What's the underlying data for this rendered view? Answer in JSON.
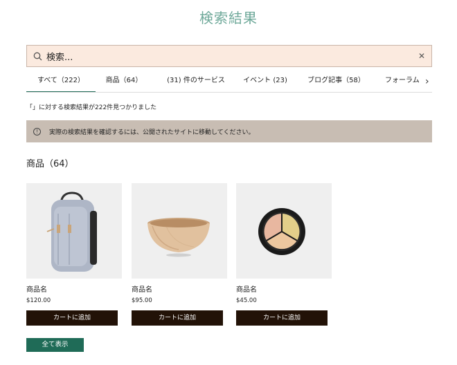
{
  "page": {
    "title": "検索結果"
  },
  "search": {
    "value": "検索..."
  },
  "tabs": [
    {
      "label": "すべて（222）"
    },
    {
      "label": "商品（64）"
    },
    {
      "label": "(31) 件のサービス"
    },
    {
      "label": "イベント (23)"
    },
    {
      "label": "ブログ記事（58）"
    },
    {
      "label": "フォーラム"
    }
  ],
  "results": {
    "summary": "「」に対する検索結果が222件見つかりました"
  },
  "notice": {
    "text": "実際の検索結果を確認するには、公開されたサイトに移動してください。"
  },
  "section": {
    "title": "商品（64）"
  },
  "products": [
    {
      "name": "商品名",
      "price": "$120.00",
      "button": "カートに追加",
      "image": "backpack"
    },
    {
      "name": "商品名",
      "price": "$95.00",
      "button": "カートに追加",
      "image": "wooden-bowl"
    },
    {
      "name": "商品名",
      "price": "$45.00",
      "button": "カートに追加",
      "image": "concealer-palette"
    }
  ],
  "show_all": "全て表示",
  "colors": {
    "accent": "#1f6b57",
    "title": "#6fa99a",
    "search_bg": "#fbeadf",
    "notice_bg": "#c8bdb3",
    "button_dark": "#221207"
  }
}
